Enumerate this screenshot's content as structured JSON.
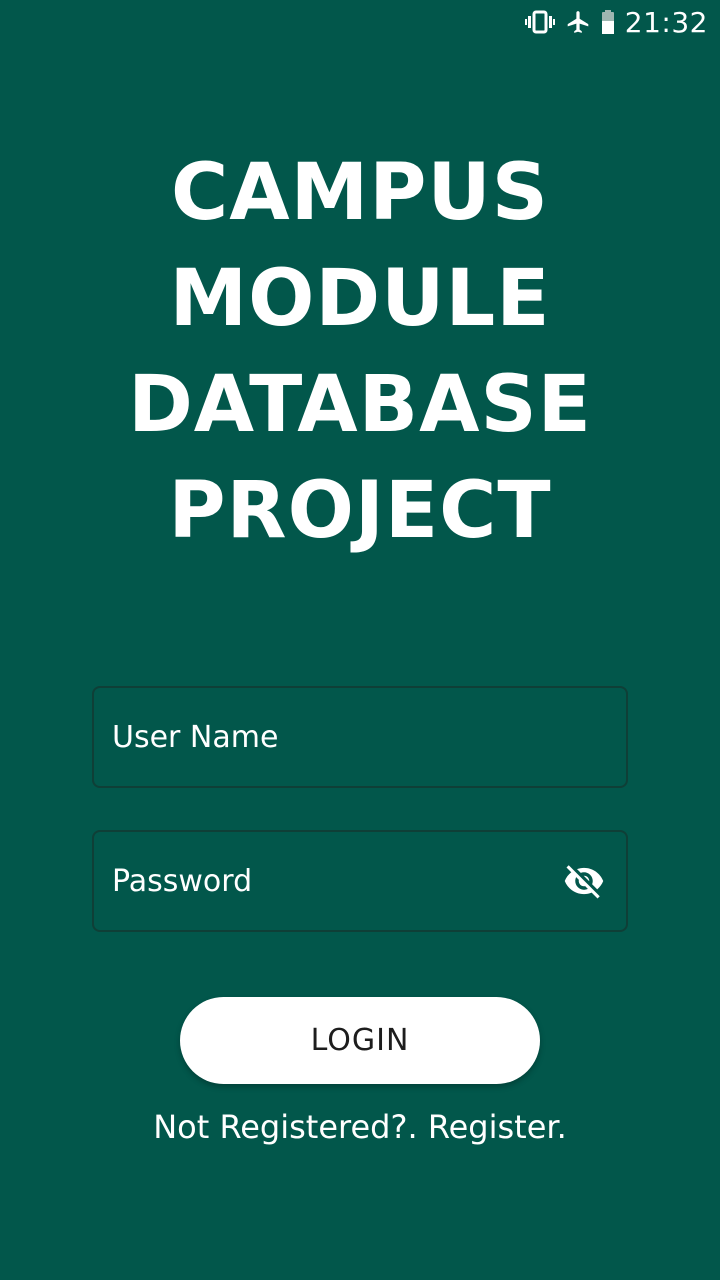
{
  "status_bar": {
    "time": "21:32",
    "icons": [
      "vibrate-icon",
      "airplane-mode-icon",
      "battery-icon"
    ]
  },
  "title": {
    "lines": [
      "CAMPUS MODULE",
      "DATABASE",
      "PROJECT"
    ]
  },
  "form": {
    "username_placeholder": "User Name",
    "username_value": "",
    "password_placeholder": "Password",
    "password_value": "",
    "visibility_icon": "visibility-off-icon",
    "login_label": "LOGIN",
    "register_text": "Not Registered?. Register."
  },
  "colors": {
    "background": "#02574b",
    "field_border": "#0f3f37",
    "button_bg": "#ffffff",
    "button_text": "#1d1d1d"
  }
}
